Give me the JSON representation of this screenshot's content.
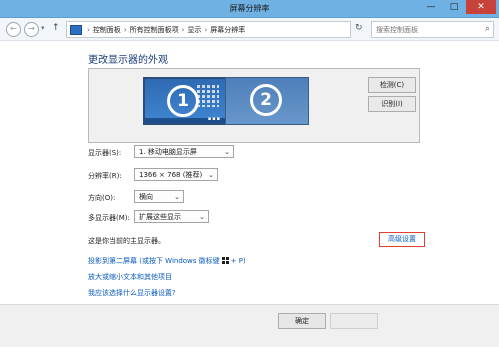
{
  "window": {
    "title": "屏幕分辨率",
    "min": "—",
    "max": "□",
    "close": "✕"
  },
  "nav": {
    "back": "←",
    "forward": "→",
    "history": "▾",
    "up": "↑",
    "breadcrumbs": [
      "控制面板",
      "所有控制面板项",
      "显示",
      "屏幕分辨率"
    ],
    "separator": "›",
    "address_dropdown": "▾",
    "refresh": "↻",
    "search_placeholder": "搜索控制面板",
    "search_icon": "⌕"
  },
  "heading": "更改显示器的外观",
  "monitors": {
    "monitor1_number": "1",
    "monitor2_number": "2",
    "monitor1_dots": "▪▪▪",
    "detect_label": "检测(C)",
    "identify_label": "识别(I)"
  },
  "settings": {
    "display_label": "显示器(S):",
    "display_value": "1. 移动电脑显示屏",
    "resolution_label": "分辨率(R):",
    "resolution_value": "1366 × 768 (推荐)",
    "orientation_label": "方向(O):",
    "orientation_value": "横向",
    "multi_label": "多显示器(M):",
    "multi_value": "扩展这些显示",
    "dropdown_arrow": "⌄"
  },
  "primary_text": "这是你当前的主显示器。",
  "advanced_label": "高级设置",
  "links": {
    "project_prefix": "投影到第二屏幕 (或按下 Windows 徽标键",
    "project_suffix": "+ P)",
    "text_size": "放大或缩小文本和其他项目",
    "which_settings": "我应该选择什么显示器设置?"
  },
  "footer": {
    "ok_label": "确定"
  }
}
